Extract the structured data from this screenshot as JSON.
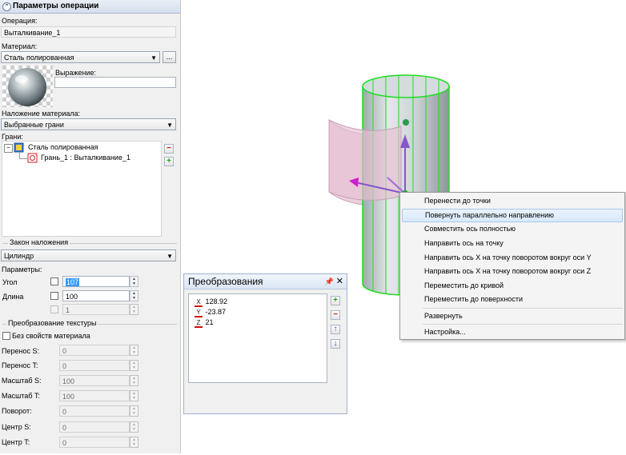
{
  "panel": {
    "title": "Параметры операции",
    "operation_label": "Операция:",
    "operation_value": "Выталкивание_1",
    "material_label": "Материал:",
    "material_value": "Сталь полированная",
    "material_browse": "...",
    "expression_label": "Выражение:",
    "expression_value": "",
    "mapping_label": "Наложение материала:",
    "mapping_value": "Выбранные грани",
    "faces_label": "Грани:",
    "tree": [
      {
        "label": "Сталь полированная"
      },
      {
        "label": "Грань_1 : Выталкивание_1"
      }
    ],
    "remove_button": "−",
    "add_button": "+",
    "law_group": "Закон наложения",
    "law_value": "Цилиндр",
    "params_label": "Параметры:",
    "angle_label": "Угол",
    "angle_value": "107",
    "length_label": "Длина",
    "length_value": "100",
    "third_value": "1",
    "texture_group": "Преобразование текстуры",
    "no_material_props": "Без свойств материала",
    "texture_rows": [
      {
        "label": "Перенос S:",
        "value": "0"
      },
      {
        "label": "Перенос T:",
        "value": "0"
      },
      {
        "label": "Масштаб S:",
        "value": "100"
      },
      {
        "label": "Масштаб T:",
        "value": "100"
      },
      {
        "label": "Поворот:",
        "value": "0"
      },
      {
        "label": "Центр S:",
        "value": "0"
      },
      {
        "label": "Центр T:",
        "value": "0"
      }
    ]
  },
  "transform_dialog": {
    "title": "Преобразования",
    "pin_icon": "pin-icon",
    "close_icon": "close-icon",
    "items": [
      {
        "axis": "X",
        "value": "128.92"
      },
      {
        "axis": "Y",
        "value": "-23.87"
      },
      {
        "axis": "Z",
        "value": "21"
      }
    ],
    "buttons": {
      "add": "+",
      "remove": "−",
      "up": "↑",
      "down": "↓"
    }
  },
  "context_menu": {
    "items": [
      "Перенести до точки",
      "Повернуть параллельно направлению",
      "Совместить ось полностью",
      "Направить ось на точку",
      "Направить ось X на точку поворотом вокруг оси Y",
      "Направить ось X на точку поворотом вокруг оси Z",
      "Переместить до кривой",
      "Переместить до поверхности",
      "Развернуть",
      "Настройка..."
    ],
    "selected_index": 1
  },
  "colors": {
    "cylinder_edge": "#22dd22",
    "cylinder_fill": "#c9d3d4",
    "band_fill": "#e8c8d8",
    "band_edge": "#c7a1b7",
    "gizmo": "#8855cc",
    "menu_highlight": "#d8e9fb",
    "remove_red": "#cc1111",
    "add_green": "#22a022",
    "arrow_blue": "#2255cc"
  }
}
